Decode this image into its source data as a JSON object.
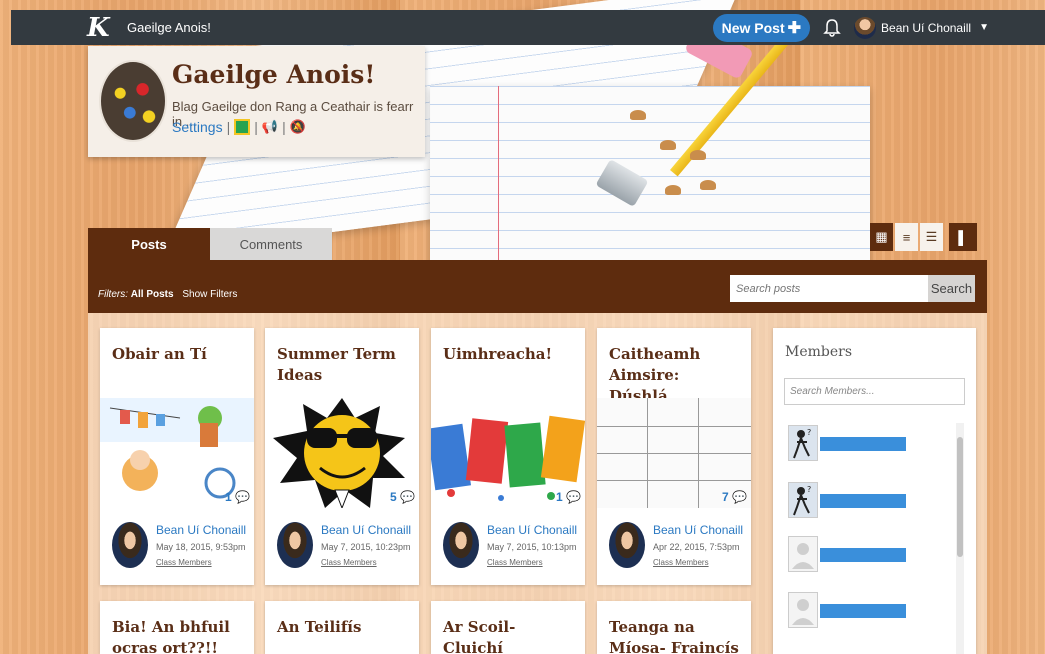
{
  "app": {
    "logo_letter": "K",
    "title": "Gaeilge Anois!"
  },
  "topbar": {
    "new_post_label": "New Post",
    "user_name": "Bean Uí Chonaill"
  },
  "blog": {
    "title": "Gaeilge Anois!",
    "description": "Blag Gaeilge don Rang a Ceathair is fearr in ...",
    "settings_label": "Settings"
  },
  "tabs": {
    "posts": "Posts",
    "comments": "Comments"
  },
  "filters": {
    "prefix": "Filters:",
    "current": "All Posts",
    "toggle": "Show Filters"
  },
  "search": {
    "placeholder": "Search posts",
    "button": "Search"
  },
  "posts": [
    {
      "title": "Obair an Tí",
      "author": "Bean Uí Chonaill",
      "date": "May 18, 2015, 9:53pm",
      "audience": "Class Members",
      "comments": "1"
    },
    {
      "title": "Summer Term Ideas",
      "author": "Bean Uí Chonaill",
      "date": "May 7, 2015, 10:23pm",
      "audience": "Class Members",
      "comments": "5"
    },
    {
      "title": "Uimhreacha!",
      "author": "Bean Uí Chonaill",
      "date": "May 7, 2015, 10:13pm",
      "audience": "Class Members",
      "comments": "1"
    },
    {
      "title": "Caitheamh Aimsire: Dúshlá ...",
      "author": "Bean Uí Chonaill",
      "date": "Apr 22, 2015, 7:53pm",
      "audience": "Class Members",
      "comments": "7"
    },
    {
      "title": "Bia! An bhfuil ocras ort??!!",
      "author": "",
      "date": "",
      "audience": "",
      "comments": ""
    },
    {
      "title": "An Teilifís",
      "author": "",
      "date": "",
      "audience": "",
      "comments": ""
    },
    {
      "title": "Ar Scoil- Cluichí",
      "author": "",
      "date": "",
      "audience": "",
      "comments": ""
    },
    {
      "title": "Teanga na Míosa- Fraincís",
      "author": "",
      "date": "",
      "audience": "",
      "comments": ""
    }
  ],
  "members": {
    "title": "Members",
    "search_placeholder": "Search Members...",
    "rows": [
      "pic",
      "pic",
      "blank",
      "blank"
    ]
  },
  "colors": {
    "brand_brown": "#5e2c0e",
    "link_blue": "#2b79c2",
    "topbar": "#333a40"
  }
}
